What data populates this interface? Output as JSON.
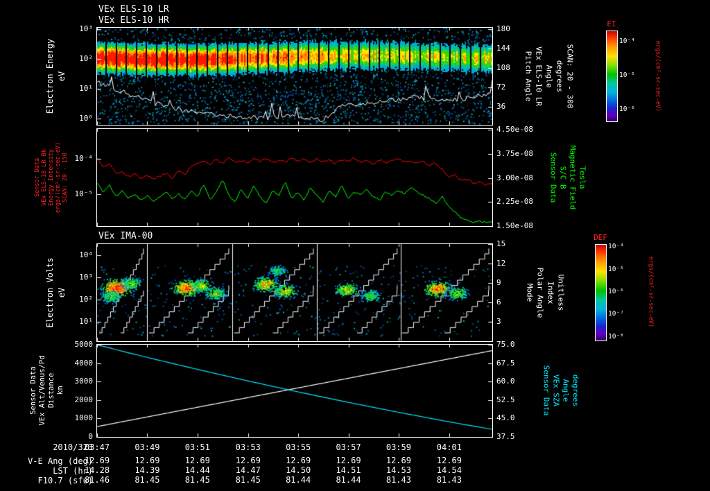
{
  "page": {
    "bg": "#000000"
  },
  "titles": {
    "els_lr": "VEx ELS-10 LR",
    "els_hr": "VEx ELS-10 HR",
    "ima": "VEx IMA-00"
  },
  "time_axis": {
    "date": "2010/323",
    "ticks": [
      "03:47",
      "03:49",
      "03:51",
      "03:53",
      "03:55",
      "03:57",
      "03:59",
      "04:01"
    ]
  },
  "table": {
    "rows": [
      {
        "label": "V-E Ang (deg)",
        "values": [
          "12.69",
          "12.69",
          "12.69",
          "12.69",
          "12.69",
          "12.69",
          "12.69",
          "12.69"
        ]
      },
      {
        "label": "LST (hr)",
        "values": [
          "14.28",
          "14.39",
          "14.44",
          "14.47",
          "14.50",
          "14.51",
          "14.53",
          "14.54"
        ]
      },
      {
        "label": "F10.7 (sfu)",
        "values": [
          "81.46",
          "81.45",
          "81.45",
          "81.45",
          "81.44",
          "81.44",
          "81.43",
          "81.43"
        ]
      }
    ]
  },
  "chart_data": [
    {
      "type": "heatmap",
      "title": "VEx ELS-10 LR",
      "title2": "VEx ELS-10 HR",
      "left_label": [
        "Electron Energy",
        "eV"
      ],
      "yscale": "log",
      "yticks": [
        "10³",
        "10²",
        "10¹",
        "10⁰"
      ],
      "right_axis": {
        "label": [
          "Pitch Angle",
          "VEx ELS-10 LR",
          "Angle",
          "degrees",
          "SCAN: 20 - 300"
        ],
        "ticks": [
          "180",
          "144",
          "108",
          "72",
          "36"
        ]
      },
      "colorbar": {
        "title": "EI",
        "units": "ergs/(cm²-sr-sec-eV)",
        "ticks": [
          "10⁻⁴",
          "10⁻⁵",
          "10⁻⁶"
        ]
      },
      "description": "Electron energy-time spectrogram: intense band near 100 eV across 03:47-04:02 with scattered low counts and white trace"
    },
    {
      "type": "line",
      "left_label": [
        "Sensor Data",
        "VEx ELS-10 LR Bk",
        "Energy Intensity",
        "ergs/(cm²-sr-sec-eV)",
        "SCAN: 20 - 150"
      ],
      "yscale": "log",
      "yticks": [
        "10⁻⁴",
        "10⁻⁵"
      ],
      "left_range_log10": [
        -3.15,
        -5.92
      ],
      "right_axis": {
        "label": [
          "Sensor Data",
          "S/C B",
          "Magnetic Field",
          "Tesla"
        ],
        "ticks": [
          "4.50e-08",
          "3.75e-08",
          "3.00e-08",
          "2.25e-08",
          "1.50e-08"
        ],
        "range_e8": [
          4.5,
          1.5
        ]
      },
      "series": [
        {
          "name": "ELS background intensity",
          "color": "#ff0000",
          "axis": "left",
          "log10_values": [
            -3.98,
            -4.28,
            -4.12,
            -4.42,
            -4.38,
            -4.52,
            -4.44,
            -4.56,
            -4.48,
            -4.6,
            -4.5,
            -4.42,
            -4.55,
            -4.35,
            -4.45,
            -4.2,
            -4.12,
            -4.05,
            -4.18,
            -4.02,
            -4.12,
            -3.98,
            -4.1,
            -4.04,
            -4.14,
            -3.96,
            -4.08,
            -4.0,
            -4.12,
            -4.02,
            -4.1,
            -3.97,
            -4.06,
            -4.0,
            -4.11,
            -3.99,
            -4.09,
            -4.03,
            -4.13,
            -4.01,
            -4.08,
            -3.98,
            -4.1,
            -4.05,
            -4.15,
            -4.02,
            -4.12,
            -4.06,
            -4.0,
            -4.1,
            -4.04,
            -4.14,
            -4.08,
            -4.18,
            -4.12,
            -4.3,
            -4.52,
            -4.45,
            -4.62,
            -4.58,
            -4.7,
            -4.66,
            -4.74,
            -4.72
          ]
        },
        {
          "name": "S/C magnetic field",
          "color": "#00ff00",
          "axis": "right",
          "values_e8": [
            2.85,
            2.55,
            2.75,
            2.4,
            2.6,
            2.35,
            2.5,
            2.3,
            2.45,
            2.25,
            2.4,
            2.55,
            2.35,
            2.5,
            2.3,
            2.6,
            2.4,
            2.8,
            2.3,
            2.55,
            2.95,
            2.45,
            2.25,
            2.65,
            2.35,
            2.75,
            2.4,
            2.2,
            2.6,
            2.45,
            2.85,
            2.35,
            2.55,
            2.3,
            2.7,
            2.45,
            2.25,
            2.6,
            2.4,
            2.75,
            2.35,
            2.55,
            2.45,
            2.65,
            2.4,
            2.3,
            2.55,
            2.45,
            2.6,
            2.5,
            2.7,
            2.55,
            2.45,
            2.35,
            2.2,
            2.42,
            2.1,
            1.95,
            1.75,
            1.68,
            1.62,
            1.66,
            1.6,
            1.63
          ]
        }
      ]
    },
    {
      "type": "heatmap",
      "title": "VEx IMA-00",
      "left_label": [
        "Electron Volts",
        "eV"
      ],
      "yscale": "log",
      "yticks": [
        "10⁴",
        "10³",
        "10²",
        "10¹"
      ],
      "right_axis": {
        "label": [
          "Mode",
          "Polar Angle",
          "Index",
          "Unitless"
        ],
        "ticks": [
          "15",
          "12",
          "9",
          "6",
          "3"
        ]
      },
      "colorbar": {
        "title": "DEF",
        "units": "ergs/(cm²-sr-sec-eV)",
        "ticks": [
          "10⁻⁴",
          "10⁻⁵",
          "10⁻⁶",
          "10⁻⁷",
          "10⁻⁸"
        ]
      },
      "segments": 5,
      "blobs": [
        {
          "x": 0.05,
          "e": 2.55,
          "s": 1.0
        },
        {
          "x": 0.035,
          "e": 2.15,
          "s": 0.45
        },
        {
          "x": 0.085,
          "e": 2.75,
          "s": 0.5
        },
        {
          "x": 0.225,
          "e": 2.55,
          "s": 0.85
        },
        {
          "x": 0.3,
          "e": 2.3,
          "s": 0.5
        },
        {
          "x": 0.262,
          "e": 2.65,
          "s": 0.55
        },
        {
          "x": 0.425,
          "e": 2.7,
          "s": 0.7
        },
        {
          "x": 0.475,
          "e": 2.4,
          "s": 0.6
        },
        {
          "x": 0.455,
          "e": 3.3,
          "s": 0.35
        },
        {
          "x": 0.63,
          "e": 2.45,
          "s": 0.6
        },
        {
          "x": 0.69,
          "e": 2.2,
          "s": 0.45
        },
        {
          "x": 0.86,
          "e": 2.5,
          "s": 0.8
        },
        {
          "x": 0.91,
          "e": 2.3,
          "s": 0.5
        }
      ],
      "description": "Ion mass analyzer spectrogram in 5 azimuth segments with white stepped polar-angle staircases and ion blobs near 100-1000 eV"
    },
    {
      "type": "line",
      "left_label": [
        "Sensor Data",
        "VEx Alt/Venus/Pd",
        "Distance",
        "km"
      ],
      "yticks": [
        "5000",
        "4000",
        "3000",
        "2000",
        "1000",
        "0"
      ],
      "left_range": [
        5000,
        0
      ],
      "right_axis": {
        "label": [
          "Sensor Data",
          "VEx SZA",
          "Angle",
          "degrees"
        ],
        "ticks": [
          "75.0",
          "67.5",
          "60.0",
          "52.5",
          "45.0",
          "37.5"
        ],
        "range": [
          75.0,
          37.5
        ]
      },
      "series": [
        {
          "name": "Altitude",
          "color": "#ffffff",
          "axis": "left",
          "values": [
            560,
            818,
            1075,
            1333,
            1590,
            1848,
            2105,
            2363,
            2620,
            2878,
            3135,
            3393,
            3650,
            3908,
            4165,
            4423,
            4680
          ]
        },
        {
          "name": "Solar zenith angle",
          "color": "#00e5ff",
          "axis": "right",
          "values": [
            75.0,
            72.4,
            69.9,
            67.5,
            65.1,
            62.8,
            60.5,
            58.3,
            56.1,
            54.0,
            51.9,
            49.9,
            47.9,
            46.0,
            44.1,
            42.3,
            40.6
          ]
        }
      ]
    }
  ]
}
